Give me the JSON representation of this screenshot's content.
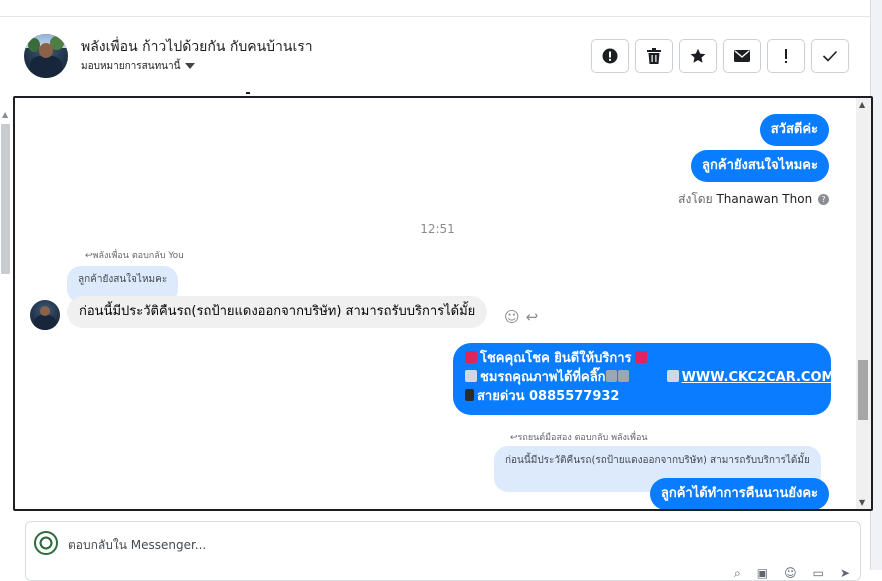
{
  "header": {
    "page_name": "พลังเพื่อน ก้าวไปด้วยกัน กับคนบ้านเรา",
    "assign_label": "มอบหมายการสนทนานี้",
    "actions": [
      {
        "name": "spam-action-button",
        "icon": "exclamation-circle-icon"
      },
      {
        "name": "delete-action-button",
        "icon": "trash-icon"
      },
      {
        "name": "star-action-button",
        "icon": "star-icon"
      },
      {
        "name": "mark-unread-action-button",
        "icon": "envelope-icon"
      },
      {
        "name": "follow-up-action-button",
        "icon": "exclamation-icon"
      },
      {
        "name": "mark-done-action-button",
        "icon": "check-icon"
      }
    ]
  },
  "thread": {
    "outgoing_1": "สวัสดีค่ะ",
    "outgoing_2": "ลูกค้ายังสนใจไหมคะ",
    "sent_by_prefix": "ส่งโดย",
    "sent_by_name": "Thanawan Thon",
    "timestamp": "12:51",
    "reply_label_1": "พลังเพื่อน ตอบกลับ You",
    "quoted_1": "ลูกค้ายังสนใจไหมคะ",
    "incoming_1": "ก่อนนี้มีประวัติคืนรถ(รถป้ายแดงออกจากบริษัท) สามารถรับบริการได้มั้ย",
    "promo_line_1": "โชคคุณโชค ยินดีให้บริการ",
    "promo_line_2a": "ชมรถคุณภาพได้ที่คลิ๊ก",
    "promo_line_2b": "WWW.CKC2CAR.COM",
    "promo_line_3": "สายด่วน 0885577932",
    "reply_label_2": "รถยนต์มือสอง ตอบกลับ พลังเพื่อน",
    "quoted_2": "ก่อนนี้มีประวัติคืนรถ(รถป้ายแดงออกจากบริษัท) สามารถรับบริการได้มั้ย",
    "outgoing_3": "ลูกค้าได้ทำการคืนนานยังคะ"
  },
  "composer": {
    "placeholder": "ตอบกลับใน Messenger..."
  },
  "colors": {
    "accent": "#0a7cff",
    "incoming_bg": "#f0f0f0",
    "quoted_bg": "#dceafc"
  }
}
